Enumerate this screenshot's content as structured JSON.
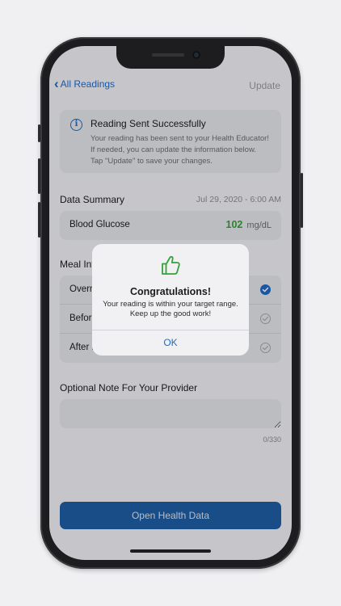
{
  "nav": {
    "back_label": "All Readings",
    "update_label": "Update"
  },
  "banner": {
    "title": "Reading Sent Successfully",
    "line1": "Your reading has been sent to your Health Educator!",
    "line2": "If needed, you can update the information below.",
    "line3": "Tap \"Update\" to save your changes."
  },
  "data_summary": {
    "title": "Data Summary",
    "date": "Jul 29, 2020 - 6:00 AM",
    "label": "Blood Glucose",
    "value": "102",
    "unit": "mg/dL"
  },
  "meal_info": {
    "title": "Meal Info",
    "options": [
      {
        "label": "Overnight",
        "selected": true
      },
      {
        "label": "Before Meal",
        "selected": false
      },
      {
        "label": "After Meal",
        "selected": false
      }
    ]
  },
  "note": {
    "title": "Optional Note For Your Provider",
    "value": "",
    "counter": "0/330"
  },
  "open_button": "Open Health Data",
  "alert": {
    "icon": "thumbs-up-icon",
    "title": "Congratulations!",
    "line1": "Your reading is within your target range.",
    "line2": "Keep up the good work!",
    "ok": "OK"
  },
  "colors": {
    "accent": "#1f6bc7",
    "success": "#34a13a",
    "button": "#1f5fa5"
  }
}
